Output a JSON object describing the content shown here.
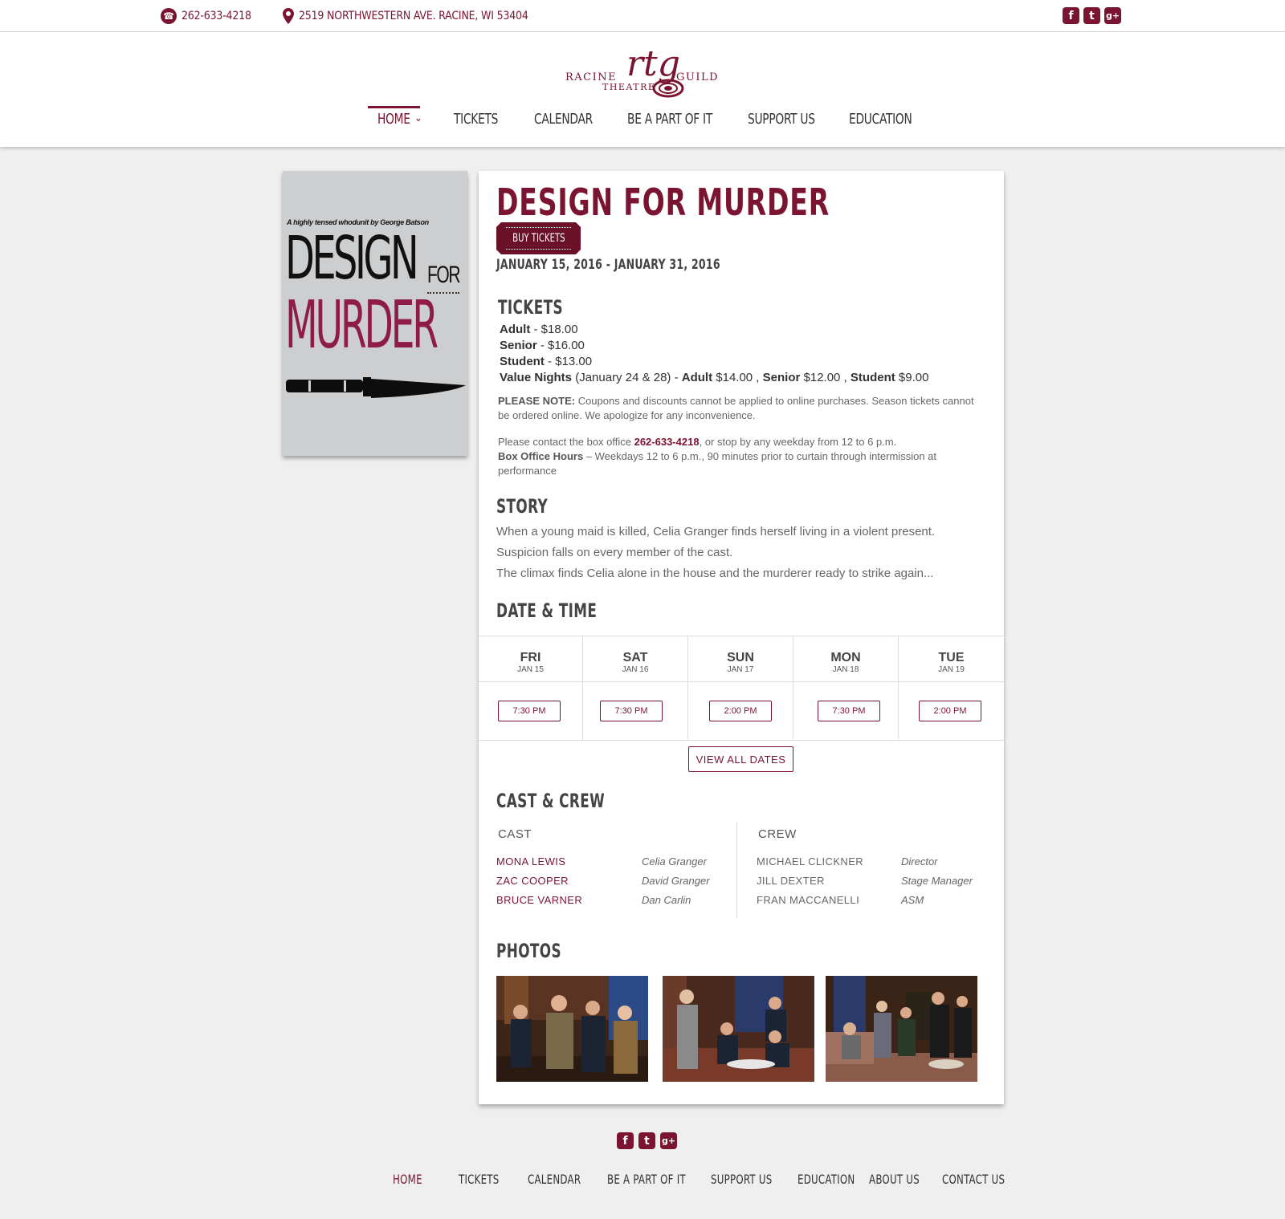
{
  "topbar": {
    "phone": "262-633-4218",
    "address": "2519 NORTHWESTERN AVE. RACINE, WI 53404",
    "social": [
      "facebook-icon",
      "twitter-icon",
      "google-plus-icon"
    ]
  },
  "logo": {
    "left_word": "RACINE",
    "middle_word": "THEATRE",
    "right_word": "GUILD",
    "monogram": "rtg"
  },
  "nav": {
    "items": [
      "HOME",
      "TICKETS",
      "CALENDAR",
      "BE A PART OF IT",
      "SUPPORT US",
      "EDUCATION"
    ],
    "active": "HOME"
  },
  "poster": {
    "byline": "A highly tensed whodunit by George Batson",
    "word1": "DESIGN",
    "word2": "FOR",
    "word3": "MURDER"
  },
  "show": {
    "title": "DESIGN FOR MURDER",
    "buy_label": "BUY TICKETS",
    "dates": "JANUARY 15, 2016 -  JANUARY 31, 2016"
  },
  "tickets": {
    "heading": "TICKETS",
    "adult_label": "Adult",
    "adult_price": " - $18.00",
    "senior_label": "Senior",
    "senior_price": " - $16.00",
    "student_label": "Student",
    "student_price": " - $13.00",
    "value_label": "Value Nights",
    "value_dates": " (January 24 & 28) - ",
    "value_adult_label": "Adult",
    "value_adult_price": " $14.00 , ",
    "value_senior_label": "Senior",
    "value_senior_price": " $12.00 , ",
    "value_student_label": "Student",
    "value_student_price": " $9.00",
    "note_label": "PLEASE NOTE:",
    "note_text": " Coupons and discounts cannot be applied to online purchases. Season tickets cannot be ordered online. We apologize for any inconvenience.",
    "contact_pre": "Please contact the box office ",
    "contact_phone": "262-633-4218",
    "contact_post": ", or stop by any weekday from 12 to 6 p.m.",
    "hours_label": "Box Office Hours",
    "hours_text": " – Weekdays 12 to 6 p.m., 90 minutes prior to curtain through intermission at performance"
  },
  "story": {
    "heading": "STORY",
    "line1": "When a young maid is killed, Celia Granger finds herself living in a violent present.",
    "line2": "Suspicion falls on every member of the cast.",
    "line3": "The climax finds Celia alone in the house and the murderer ready to strike again..."
  },
  "datetime": {
    "heading": "DATE & TIME",
    "days": [
      {
        "day": "FRI",
        "date": "JAN 15",
        "time": "7:30 PM"
      },
      {
        "day": "SAT",
        "date": "JAN 16",
        "time": "7:30 PM"
      },
      {
        "day": "SUN",
        "date": "JAN 17",
        "time": "2:00 PM"
      },
      {
        "day": "MON",
        "date": "JAN 18",
        "time": "7:30 PM"
      },
      {
        "day": "TUE",
        "date": "JAN 19",
        "time": "2:00 PM"
      }
    ],
    "view_all": "VIEW ALL DATES"
  },
  "cast_crew": {
    "heading": "CAST & CREW",
    "cast_label": "CAST",
    "crew_label": "CREW",
    "cast": [
      {
        "name": "MONA LEWIS",
        "role": "Celia Granger"
      },
      {
        "name": "ZAC COOPER",
        "role": "David Granger"
      },
      {
        "name": "BRUCE VARNER",
        "role": "Dan Carlin"
      }
    ],
    "crew": [
      {
        "name": "MICHAEL CLICKNER",
        "role": "Director"
      },
      {
        "name": "JILL DEXTER",
        "role": "Stage Manager"
      },
      {
        "name": "FRAN MACCANELLI",
        "role": "ASM"
      }
    ]
  },
  "photos": {
    "heading": "PHOTOS"
  },
  "footer": {
    "social": [
      "facebook-icon",
      "twitter-icon",
      "google-plus-icon"
    ],
    "nav": [
      "HOME",
      "TICKETS",
      "CALENDAR",
      "BE A PART OF IT",
      "SUPPORT US",
      "EDUCATION",
      "ABOUT US",
      "CONTACT US"
    ],
    "active": "HOME"
  },
  "colors": {
    "brand": "#7a1430",
    "background": "#efefef"
  }
}
